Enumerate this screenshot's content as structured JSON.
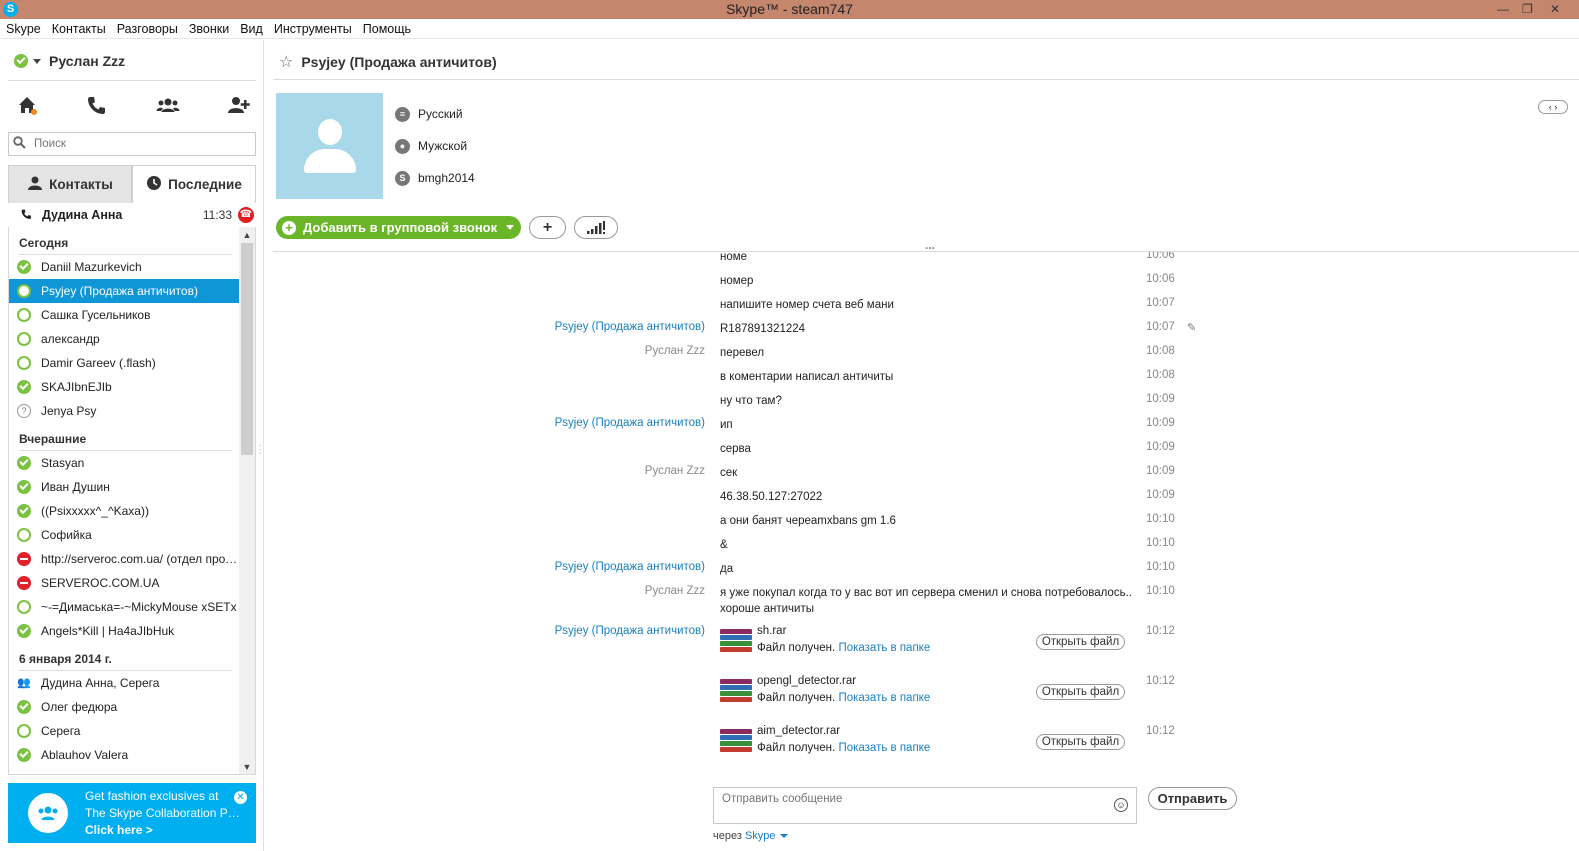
{
  "window": {
    "title": "Skype™ - steam747"
  },
  "menu": [
    "Skype",
    "Контакты",
    "Разговоры",
    "Звонки",
    "Вид",
    "Инструменты",
    "Помощь"
  ],
  "user": {
    "name": "Руслан Zzz",
    "status_color": "#7cc242"
  },
  "search": {
    "placeholder": "Поиск"
  },
  "tabs": {
    "contacts": "Контакты",
    "recent": "Последние"
  },
  "active_call": {
    "name": "Дудина Анна",
    "time": "11:33"
  },
  "sections": [
    {
      "title": "Сегодня",
      "contacts": [
        {
          "name": "Daniil Mazurkevich",
          "status": "online"
        },
        {
          "name": "Psyjey (Продажа античитов)",
          "status": "offline",
          "selected": true
        },
        {
          "name": "Сашка Гусельников",
          "status": "offline"
        },
        {
          "name": "александр",
          "status": "offline"
        },
        {
          "name": "Damir Gareev (.flash)",
          "status": "offline"
        },
        {
          "name": "SKAJIbnEJIb",
          "status": "online"
        },
        {
          "name": "Jenya Psy",
          "status": "unknown"
        }
      ]
    },
    {
      "title": "Вчерашние",
      "contacts": [
        {
          "name": "Stasyan",
          "status": "online"
        },
        {
          "name": "Иван Душин",
          "status": "online"
        },
        {
          "name": "((Psixxxxx^_^Kaxa))",
          "status": "online"
        },
        {
          "name": "Софийка",
          "status": "offline"
        },
        {
          "name": "http://serveroc.com.ua/ (отдел прод…",
          "status": "blocked"
        },
        {
          "name": "SERVEROC.COM.UA",
          "status": "blocked"
        },
        {
          "name": "~-=Димаська=-~MickyMouse xSETx",
          "status": "offline"
        },
        {
          "name": "Angels*Kill | Ha4aJIbHuk",
          "status": "online"
        }
      ]
    },
    {
      "title": "6 января 2014 г.",
      "contacts": [
        {
          "name": "Дудина Анна, Серега",
          "status": "group"
        },
        {
          "name": "Олег федюра",
          "status": "online"
        },
        {
          "name": "Серега",
          "status": "offline"
        },
        {
          "name": "Ablauhov Valera",
          "status": "online"
        }
      ]
    }
  ],
  "promo": {
    "text": "Get fashion exclusives at The Skype Collaboration P…",
    "link": "Click here >"
  },
  "conversation": {
    "title": "Psyjey (Продажа античитов)",
    "language": "Русский",
    "gender": "Мужской",
    "skype_name": "bmgh2014",
    "add_to_call": "Добавить в групповой звонок"
  },
  "messages": [
    {
      "sender": "",
      "text": "номе",
      "time": "10:06"
    },
    {
      "sender": "",
      "text": "номер",
      "time": "10:06"
    },
    {
      "sender": "",
      "text": "напишите номер счета веб мани",
      "time": "10:07"
    },
    {
      "sender": "Psyjey (Продажа античитов)",
      "sender_type": "other",
      "text": "R187891321224",
      "time": "10:07"
    },
    {
      "sender": "Руслан Zzz",
      "sender_type": "me",
      "text": "перевел",
      "time": "10:08"
    },
    {
      "sender": "",
      "text": "в коментарии написал античиты",
      "time": "10:08"
    },
    {
      "sender": "",
      "text": "ну что там?",
      "time": "10:09"
    },
    {
      "sender": "Psyjey (Продажа античитов)",
      "sender_type": "other",
      "text": "ип",
      "time": "10:09"
    },
    {
      "sender": "",
      "text": "серва",
      "time": "10:09"
    },
    {
      "sender": "Руслан Zzz",
      "sender_type": "me",
      "text": "сек",
      "time": "10:09"
    },
    {
      "sender": "",
      "text": "46.38.50.127:27022",
      "time": "10:09"
    },
    {
      "sender": "",
      "text": "а они банят череamxbans gm 1.6",
      "time": "10:10"
    },
    {
      "sender": "",
      "text": "&",
      "time": "10:10"
    },
    {
      "sender": "Psyjey (Продажа античитов)",
      "sender_type": "other",
      "text": "да",
      "time": "10:10"
    },
    {
      "sender": "Руслан Zzz",
      "sender_type": "me",
      "text": " я уже покупал когда то у вас вот ип сервера сменил и снова потребовалось.. хороше античиты",
      "time": "10:10"
    }
  ],
  "files_sender": "Psyjey (Продажа античитов)",
  "files": [
    {
      "name": "sh.rar",
      "status": "Файл получен.",
      "show": "Показать в папке",
      "open": "Открыть файл",
      "time": "10:12"
    },
    {
      "name": "opengl_detector.rar",
      "status": "Файл получен.",
      "show": "Показать в папке",
      "open": "Открыть файл",
      "time": "10:12"
    },
    {
      "name": "aim_detector.rar",
      "status": "Файл получен.",
      "show": "Показать в папке",
      "open": "Открыть файл",
      "time": "10:12"
    }
  ],
  "compose": {
    "placeholder": "Отправить сообщение",
    "send": "Отправить",
    "via_label": "через",
    "via_service": "Skype"
  }
}
